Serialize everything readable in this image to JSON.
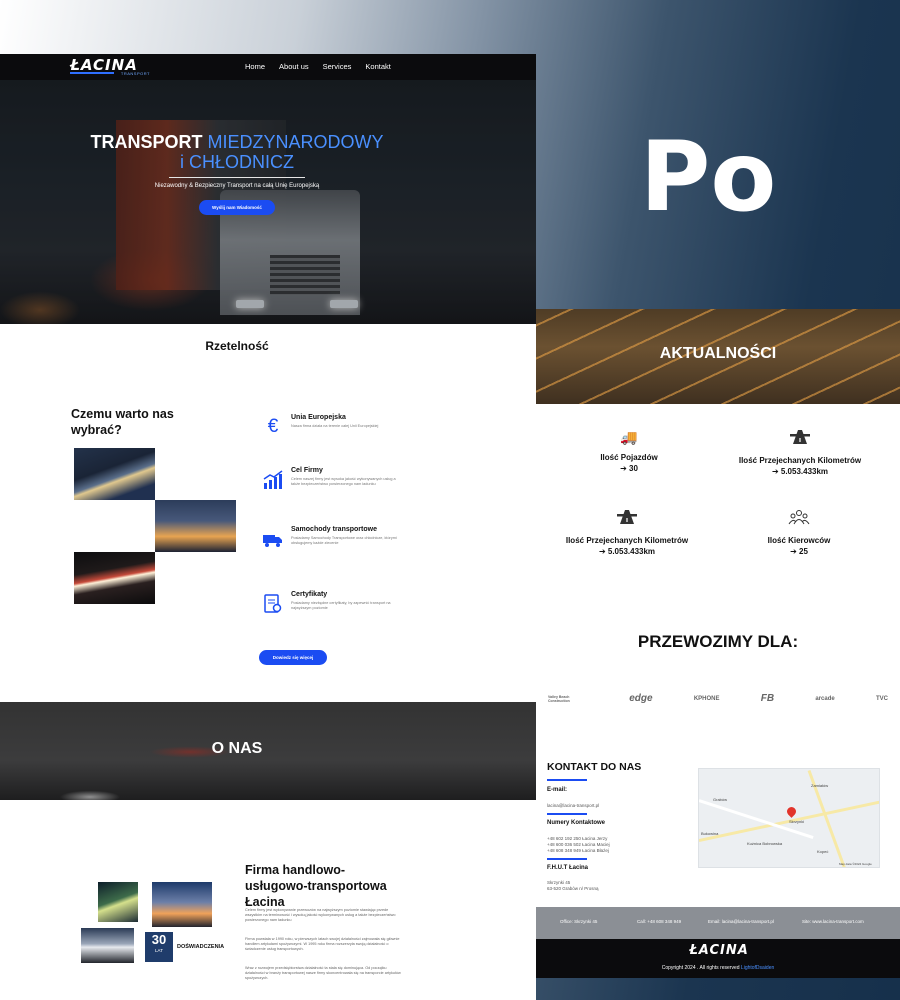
{
  "brand": {
    "logo_text": "ŁACINA",
    "logo_sub": "TRANSPORT"
  },
  "nav": {
    "items": [
      "Home",
      "About us",
      "Services",
      "Kontakt"
    ]
  },
  "hero": {
    "title_white": "TRANSPORT ",
    "title_blue_1": "MIEDZYNARODOWY",
    "title_blue_2": "i CHŁODNICZ",
    "subtitle": "Niezawodny & Bezpieczny Transport na całą Unię Europejską",
    "button": "Wyślij nam Wiadomość"
  },
  "reliability": {
    "title": "Rzetelność"
  },
  "why": {
    "title": "Czemu warto nas wybrać?",
    "features": [
      {
        "icon": "euro-icon",
        "title": "Unia Europejska",
        "desc": "Nasza firma działa na terenie całej Unii Europejskiej"
      },
      {
        "icon": "chart-icon",
        "title": "Cel Firmy",
        "desc": "Celem naszej firmy jest wysoka jakość wykonywanych usług a także bezpieczeństwo powierzonego nam ładunku"
      },
      {
        "icon": "truck-icon",
        "title": "Samochody transportowe",
        "desc": "Posiadamy Samochody Transportowe oraz chłodnicze, którymi obsługujemy każde zlecenie"
      },
      {
        "icon": "certificate-icon",
        "title": "Certyfikaty",
        "desc": "Posiadamy niezbędne certyfikaty, by zapewnić transport na najwyższym poziomie"
      }
    ],
    "button": "Dowiedz się więcej"
  },
  "about": {
    "banner": "O NAS",
    "title": "Firma handlowo-usługowo-transportowa Łacina",
    "paragraphs": [
      "Celem firmy jest wykonywanie przewozów na najwyższym poziomie stawiając przede wszystkim na terminowość i wysoką jakość wykonywanych usług a także bezpieczeństwo powierzonego nam ładunku",
      "Firma powstała w 1990 roku, w pierwszych latach swojej działalności zajmowała się głównie handlem artykułami spożywczymi. W 1995 roku firma rozszerzyła swoją działalność o świadczenie usług transportowych.",
      "Wraz z rozwojem przedsiębiorstwa działalność ta stała się dominująca. Od początku działalności w branży transportowej nasze firmy skoncentrowała się na transporcie artykułów spożywczych."
    ],
    "years_number": "30",
    "years_label": "LAT",
    "experience": "DOŚWIADCZENIA"
  },
  "po_text": "Po",
  "news": {
    "title": "AKTUALNOŚCI"
  },
  "stats": [
    {
      "icon": "truck-fast-icon",
      "label": "Ilość Pojazdów",
      "value": "➔ 30"
    },
    {
      "icon": "road-icon",
      "label": "Ilość Przejechanych Kilometrów",
      "value": "➔ 5.053.433km"
    },
    {
      "icon": "road-icon",
      "label": "Ilość Przejechanych Kilometrów",
      "value": "➔ 5.053.433km"
    },
    {
      "icon": "drivers-icon",
      "label": "Ilość Kierowców",
      "value": "➔ 25"
    }
  ],
  "clients": {
    "title": "PRZEWOZIMY DLA:",
    "logos": [
      "Valley Beach Construction",
      "edge",
      "KPHONE",
      "FB",
      "arcade",
      "TVC"
    ]
  },
  "contact": {
    "title": "KONTAKT DO NAS",
    "email_label": "E-mail:",
    "email": "lacina@lacina-transport.pl",
    "phones_label": "Numery Kontaktowe",
    "phones": [
      "+48 602 192 250 Łacina Jerzy",
      "+48 600 036 502 Łacina Maciej",
      "+48 608 348 949 Łacina Błażej"
    ],
    "company": "F.H.U.T Łacina",
    "address_1": "Skrzynki 45",
    "address_2": "63-520 Grabów n/ Prosną"
  },
  "map": {
    "labels": [
      "Zamiałów",
      "Grabów",
      "Skrzynki",
      "Kuźnica Bobrowska",
      "Bukowina",
      "Kopeć",
      "Map data ©2024 Google"
    ]
  },
  "infobar": {
    "office": "Office: Skrzynki 45",
    "call": "Call: +48 608 348 949",
    "email": "Email: lacina@lacina-transport.pl",
    "site": "Site: www.lacina-transport.com"
  },
  "footer": {
    "logo": "ŁACINA",
    "copyright": "Copyright 2024 . All rights reserved ",
    "author": "LightofDsaiden"
  }
}
